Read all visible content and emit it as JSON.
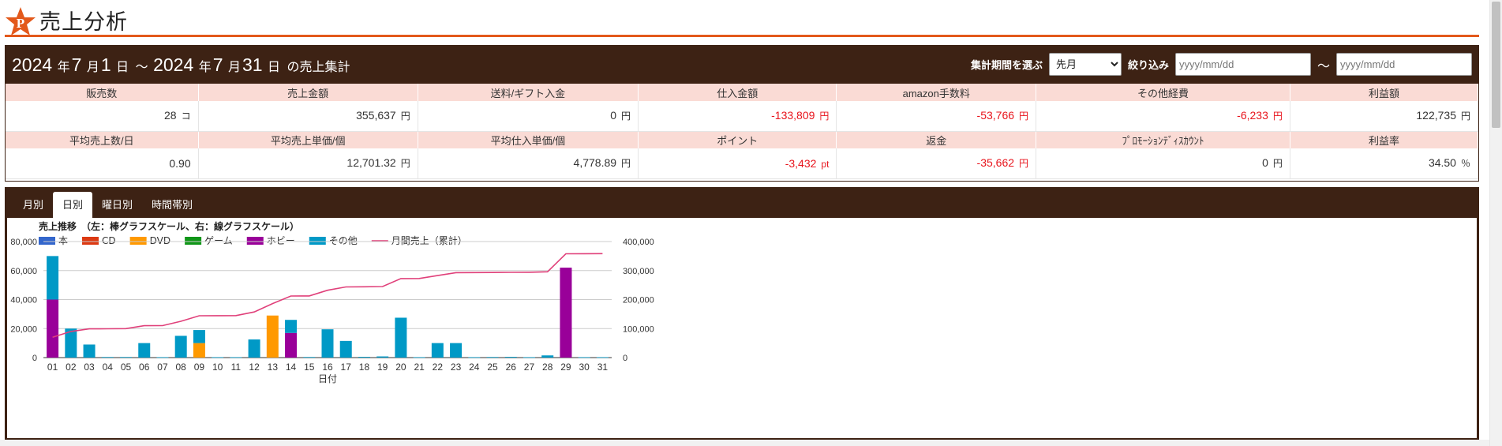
{
  "page": {
    "title": "売上分析"
  },
  "colors": {
    "accent": "#e3591b",
    "header_bg": "#3d2214",
    "label_bg": "#fadbd5",
    "negative": "#e8141c",
    "line": "#e0407a"
  },
  "summary": {
    "start_year": "2024",
    "start_month": "7",
    "start_day": "1",
    "end_year": "2024",
    "end_month": "7",
    "end_day": "31",
    "year_label": "年",
    "month_label": "月",
    "day_label": "日",
    "range_sep": "～",
    "suffix": "の売上集計",
    "filters": {
      "period_label": "集計期間を選ぶ",
      "period_value": "先月",
      "narrow_label": "絞り込み",
      "from_placeholder": "yyyy/mm/dd",
      "to_placeholder": "yyyy/mm/dd",
      "tilde": "～"
    }
  },
  "stats_rows": [
    {
      "headers": [
        "販売数",
        "売上金額",
        "送料/ギフト入金",
        "仕入金額",
        "amazon手数料",
        "その他経費",
        "利益額"
      ],
      "values": [
        {
          "value": "28",
          "unit": "コ",
          "neg": false
        },
        {
          "value": "355,637",
          "unit": "円",
          "neg": false
        },
        {
          "value": "0",
          "unit": "円",
          "neg": false
        },
        {
          "value": "-133,809",
          "unit": "円",
          "neg": true
        },
        {
          "value": "-53,766",
          "unit": "円",
          "neg": true
        },
        {
          "value": "-6,233",
          "unit": "円",
          "neg": true
        },
        {
          "value": "122,735",
          "unit": "円",
          "neg": false
        }
      ]
    },
    {
      "headers": [
        "平均売上数/日",
        "平均売上単価/個",
        "平均仕入単価/個",
        "ポイント",
        "返金",
        "ﾌﾟﾛﾓｰｼｮﾝﾃﾞｨｽｶｳﾝﾄ",
        "利益率"
      ],
      "values": [
        {
          "value": "0.90",
          "unit": "",
          "neg": false
        },
        {
          "value": "12,701.32",
          "unit": "円",
          "neg": false
        },
        {
          "value": "4,778.89",
          "unit": "円",
          "neg": false
        },
        {
          "value": "-3,432",
          "unit": "pt",
          "neg": true
        },
        {
          "value": "-35,662",
          "unit": "円",
          "neg": true
        },
        {
          "value": "0",
          "unit": "円",
          "neg": false
        },
        {
          "value": "34.50",
          "unit": "％",
          "neg": false
        }
      ]
    }
  ],
  "tabs": [
    "月別",
    "日別",
    "曜日別",
    "時間帯別"
  ],
  "active_tab": 1,
  "chart_data": {
    "type": "bar",
    "title": "売上推移　（左：棒グラフスケール、右：線グラフスケール）",
    "xlabel": "日付",
    "ylabel": "",
    "ylim": [
      0,
      80000
    ],
    "y2lim": [
      0,
      400000
    ],
    "yticks": [
      "0",
      "20,000",
      "40,000",
      "60,000",
      "80,000"
    ],
    "y2ticks": [
      "0",
      "100,000",
      "200,000",
      "300,000",
      "400,000"
    ],
    "grid": true,
    "legend_position": "top-left",
    "categories": [
      "01",
      "02",
      "03",
      "04",
      "05",
      "06",
      "07",
      "08",
      "09",
      "10",
      "11",
      "12",
      "13",
      "14",
      "15",
      "16",
      "17",
      "18",
      "19",
      "20",
      "21",
      "22",
      "23",
      "24",
      "25",
      "26",
      "27",
      "28",
      "29",
      "30",
      "31"
    ],
    "series": [
      {
        "name": "本",
        "kind": "bar",
        "color": "#3366cc",
        "values": [
          0,
          0,
          0,
          0,
          0,
          0,
          0,
          0,
          0,
          0,
          0,
          0,
          0,
          0,
          0,
          0,
          0,
          0,
          0,
          0,
          0,
          0,
          0,
          0,
          0,
          0,
          0,
          0,
          0,
          0,
          0
        ]
      },
      {
        "name": "CD",
        "kind": "bar",
        "color": "#dc3912",
        "values": [
          0,
          0,
          0,
          0,
          0,
          0,
          0,
          0,
          0,
          0,
          0,
          0,
          0,
          0,
          0,
          0,
          0,
          0,
          0,
          0,
          0,
          0,
          0,
          0,
          0,
          0,
          0,
          0,
          0,
          0,
          0
        ]
      },
      {
        "name": "DVD",
        "kind": "bar",
        "color": "#ff9900",
        "values": [
          0,
          0,
          0,
          0,
          0,
          0,
          0,
          0,
          10000,
          0,
          0,
          0,
          29000,
          0,
          0,
          0,
          0,
          0,
          0,
          0,
          0,
          0,
          0,
          0,
          0,
          0,
          0,
          0,
          0,
          0,
          0
        ]
      },
      {
        "name": "ゲーム",
        "kind": "bar",
        "color": "#109618",
        "values": [
          0,
          0,
          0,
          0,
          0,
          0,
          0,
          0,
          0,
          0,
          0,
          0,
          0,
          0,
          0,
          0,
          0,
          0,
          0,
          0,
          0,
          0,
          0,
          0,
          0,
          0,
          0,
          0,
          0,
          0,
          0
        ]
      },
      {
        "name": "ホビー",
        "kind": "bar",
        "color": "#990099",
        "values": [
          40000,
          0,
          0,
          0,
          0,
          0,
          0,
          0,
          0,
          0,
          0,
          0,
          0,
          17000,
          0,
          0,
          0,
          0,
          0,
          0,
          0,
          0,
          0,
          0,
          0,
          0,
          0,
          0,
          62000,
          0,
          0
        ]
      },
      {
        "name": "その他",
        "kind": "bar",
        "color": "#0099c6",
        "values": [
          30000,
          20000,
          9000,
          400,
          400,
          10000,
          300,
          15000,
          9000,
          300,
          300,
          12500,
          0,
          9000,
          400,
          19500,
          11500,
          500,
          800,
          27500,
          300,
          10000,
          10000,
          300,
          400,
          500,
          300,
          1500,
          0,
          300,
          300
        ]
      },
      {
        "name": "月間売上（累計）",
        "kind": "line",
        "color": "#e0407a",
        "axis": "right",
        "values": [
          70000,
          90000,
          99000,
          99400,
          99800,
          109800,
          110100,
          125100,
          144100,
          144400,
          144700,
          157200,
          186200,
          212200,
          212600,
          232100,
          243600,
          244100,
          244900,
          272400,
          272700,
          282700,
          292700,
          293000,
          293400,
          293900,
          294200,
          295700,
          357700,
          358000,
          358300
        ]
      }
    ]
  }
}
